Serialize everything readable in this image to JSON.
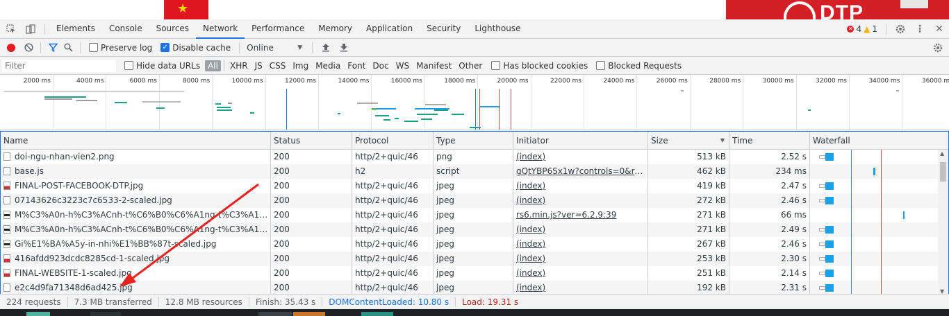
{
  "page_strip": {
    "logo_text": "DTP"
  },
  "devtools": {
    "tabs": [
      "Elements",
      "Console",
      "Sources",
      "Network",
      "Performance",
      "Memory",
      "Application",
      "Security",
      "Lighthouse"
    ],
    "active_tab": "Network",
    "errors": "4",
    "warnings": "1"
  },
  "toolbar": {
    "preserve_log": "Preserve log",
    "disable_cache": "Disable cache",
    "throttle": "Online"
  },
  "filterbar": {
    "placeholder": "Filter",
    "hide_data_urls": "Hide data URLs",
    "types": [
      "All",
      "XHR",
      "JS",
      "CSS",
      "Img",
      "Media",
      "Font",
      "Doc",
      "WS",
      "Manifest",
      "Other"
    ],
    "active_type": "All",
    "blocked_cookies": "Has blocked cookies",
    "blocked_requests": "Blocked Requests"
  },
  "overview": {
    "ticks": [
      "2000 ms",
      "4000 ms",
      "6000 ms",
      "8000 ms",
      "10000 ms",
      "12000 ms",
      "14000 ms",
      "16000 ms",
      "18000 ms",
      "20000 ms",
      "22000 ms",
      "24000 ms",
      "26000 ms",
      "28000 ms",
      "30000 ms",
      "32000 ms",
      "34000 ms",
      "36000 ms"
    ]
  },
  "table": {
    "columns": [
      "Name",
      "Status",
      "Protocol",
      "Type",
      "Initiator",
      "Size",
      "Time",
      "Waterfall"
    ],
    "rows": [
      {
        "name": "doi-ngu-nhan-vien2.png",
        "status": "200",
        "protocol": "http/2+quic/46",
        "type": "png",
        "initiator": "(index)",
        "size": "513 kB",
        "time": "2.52 s",
        "icon": "plain",
        "wf": "img"
      },
      {
        "name": "base.js",
        "status": "200",
        "protocol": "h2",
        "type": "script",
        "initiator": "gQtYBP6Sx1w?controls=0&rel=...",
        "size": "462 kB",
        "time": "234 ms",
        "icon": "plain",
        "wf": "late"
      },
      {
        "name": "FINAL-POST-FACEBOOK-DTP.jpg",
        "status": "200",
        "protocol": "http/2+quic/46",
        "type": "jpeg",
        "initiator": "(index)",
        "size": "419 kB",
        "time": "2.47 s",
        "icon": "img",
        "wf": "img"
      },
      {
        "name": "07143626c3223c7c6533-2-scaled.jpg",
        "status": "200",
        "protocol": "http/2+quic/46",
        "type": "jpeg",
        "initiator": "(index)",
        "size": "272 kB",
        "time": "2.46 s",
        "icon": "plain",
        "wf": "img"
      },
      {
        "name": "M%C3%A0n-h%C3%ACnh-t%C6%B0%C6%A1ng-t%C3%A1c-1-...",
        "status": "200",
        "protocol": "http/2+quic/46",
        "type": "jpeg",
        "initiator": "rs6.min.js?ver=6.2.9:39",
        "size": "271 kB",
        "time": "66 ms",
        "icon": "dark",
        "wf": "late2"
      },
      {
        "name": "M%C3%A0n-h%C3%ACnh-t%C6%B0%C6%A1ng-t%C3%A1c-1-...",
        "status": "200",
        "protocol": "http/2+quic/46",
        "type": "jpeg",
        "initiator": "(index)",
        "size": "271 kB",
        "time": "2.49 s",
        "icon": "dark",
        "wf": "img"
      },
      {
        "name": "Gi%E1%BA%A5y-in-nhi%E1%BB%87t-scaled.jpg",
        "status": "200",
        "protocol": "http/2+quic/46",
        "type": "jpeg",
        "initiator": "(index)",
        "size": "267 kB",
        "time": "2.46 s",
        "icon": "dark",
        "wf": "img"
      },
      {
        "name": "416afdd923dcdc8285cd-1-scaled.jpg",
        "status": "200",
        "protocol": "http/2+quic/46",
        "type": "jpeg",
        "initiator": "(index)",
        "size": "253 kB",
        "time": "2.30 s",
        "icon": "img",
        "wf": "img"
      },
      {
        "name": "FINAL-WEBSITE-1-scaled.jpg",
        "status": "200",
        "protocol": "http/2+quic/46",
        "type": "jpeg",
        "initiator": "(index)",
        "size": "251 kB",
        "time": "2.14 s",
        "icon": "img",
        "wf": "img"
      },
      {
        "name": "e2c4d9fa71348d6ad425.jpg",
        "status": "200",
        "protocol": "http/2+quic/46",
        "type": "jpeg",
        "initiator": "(index)",
        "size": "192 kB",
        "time": "2.31 s",
        "icon": "plain",
        "wf": "img"
      }
    ]
  },
  "status": {
    "requests": "224 requests",
    "transferred": "7.3 MB transferred",
    "resources": "12.8 MB resources",
    "finish": "Finish: 35.43 s",
    "dcl": "DOMContentLoaded: 10.80 s",
    "load": "Load: 19.31 s"
  },
  "colors": {
    "accent": "#1a73e8",
    "record": "#e41e25",
    "waterfall": "#1aa1e6",
    "annotation_arrow": "#e8231e"
  }
}
